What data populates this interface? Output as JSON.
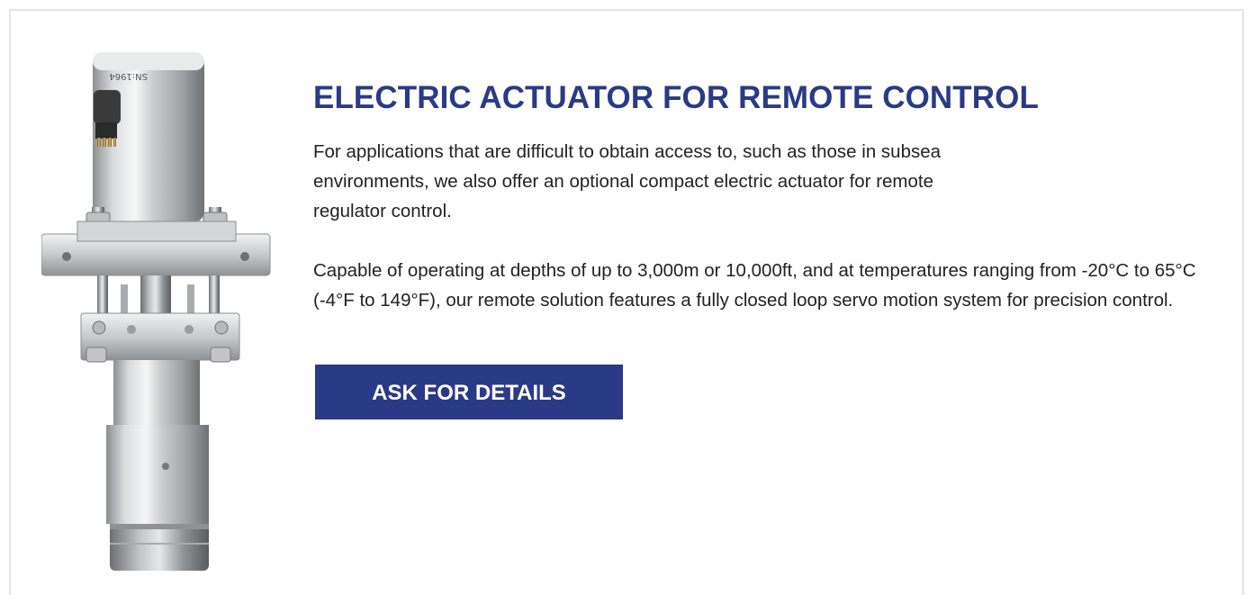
{
  "section": {
    "title": "ELECTRIC ACTUATOR FOR REMOTE CONTROL",
    "paragraphs": [
      "For applications that are difficult to obtain access to, such as those in subsea environments, we also offer an optional compact electric actuator for remote regulator control.",
      "Capable of operating at depths of up to 3,000m or 10,000ft, and at temperatures ranging from -20°C to 65°C (-4°F to 149°F), our remote solution features a fully closed loop servo motion system for precision control."
    ],
    "cta_label": "ASK FOR DETAILS",
    "product_serial": "SN:1964"
  },
  "colors": {
    "accent": "#2b3a86",
    "title": "#2a3a85",
    "body_text": "#222222",
    "border": "#e5e5e5"
  }
}
